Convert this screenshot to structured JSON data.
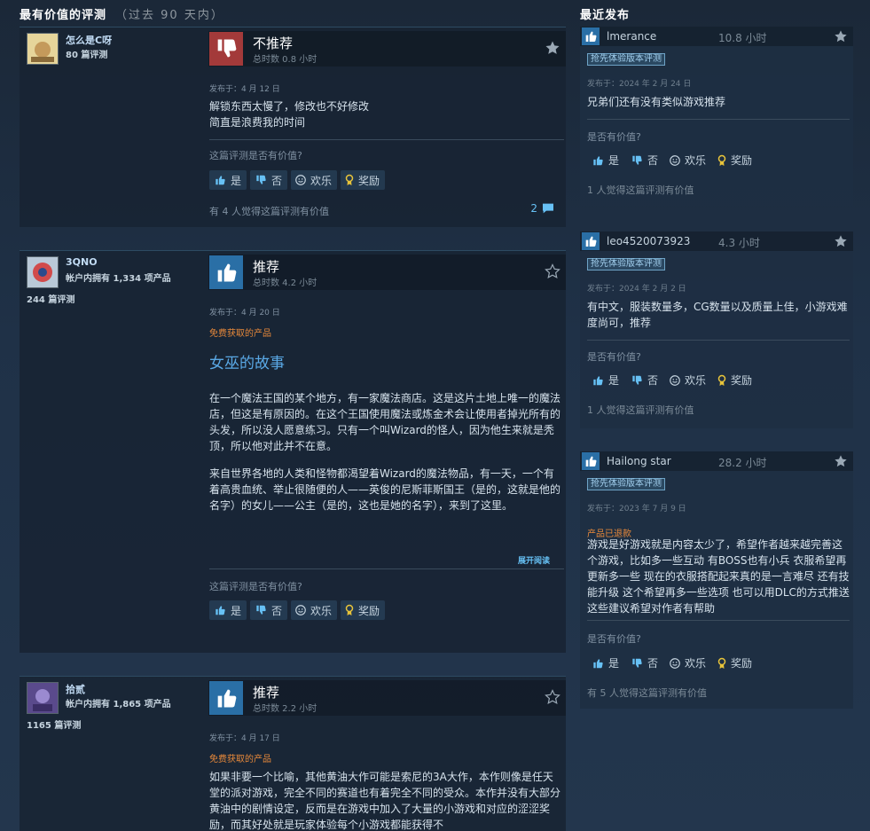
{
  "left_section": {
    "title": "最有价值的评测",
    "subtitle": "（过去 90 天内）"
  },
  "right_section": {
    "title": "最近发布"
  },
  "buttons": {
    "yes": "是",
    "no": "否",
    "funny": "欢乐",
    "award": "奖励"
  },
  "reviews": [
    {
      "author": "怎么是C呀",
      "meta1": "80 篇评测",
      "meta2": "",
      "verdict": "不推荐",
      "hours": "总时数 0.8 小时",
      "posted": "发布于：4 月 12 日",
      "free": "",
      "heading": "",
      "text": [
        "解锁东西太慢了，修改也不好修改",
        "简直是浪费我的时间"
      ],
      "helpful_q": "这篇评测是否有价值?",
      "helpful_count": "有 4 人觉得这篇评测有价值",
      "comments": "2"
    },
    {
      "author": "3QNO",
      "meta1": "帐户内拥有 1,334 项产品",
      "meta2": "244 篇评测",
      "verdict": "推荐",
      "hours": "总时数 4.2 小时",
      "posted": "发布于：4 月 20 日",
      "free": "免费获取的产品",
      "heading": "女巫的故事",
      "text": [
        "在一个魔法王国的某个地方，有一家魔法商店。这是这片土地上唯一的魔法店，但这是有原因的。在这个王国使用魔法或炼金术会让使用者掉光所有的头发，所以没人愿意练习。只有一个叫Wizard的怪人，因为他生来就是秃顶，所以他对此并不在意。",
        "来自世界各地的人类和怪物都渴望着Wizard的魔法物品，有一天，一个有着高贵血统、举止很随便的人——英俊的尼斯菲斯国王（是的，这就是他的名字）的女儿——公主（是的，这也是她的名字），来到了这里。"
      ],
      "expand": "展开阅读",
      "helpful_q": "这篇评测是否有价值?"
    },
    {
      "author": "拾贰",
      "meta1": "帐户内拥有 1,865 项产品",
      "meta2": "1165 篇评测",
      "verdict": "推荐",
      "hours": "总时数 2.2 小时",
      "posted": "发布于：4 月 17 日",
      "free": "免费获取的产品",
      "text": [
        "如果非要一个比喻，其他黄油大作可能是索尼的3A大作，本作则像是任天堂的派对游戏，完全不同的赛道也有着完全不同的受众。本作并没有大部分黄油中的剧情设定，反而是在游戏中加入了大量的小游戏和对应的涩涩奖励，而其好处就是玩家体验每个小游戏都能获得不"
      ]
    }
  ],
  "recent": [
    {
      "name": "lmerance",
      "hours": "10.8 小时",
      "badge": "抢先体验版本评测",
      "posted": "发布于：2024 年 2 月 24 日",
      "refund": "",
      "text": "兄弟们还有没有类似游戏推荐",
      "q": "是否有价值?",
      "count": "1 人觉得这篇评测有价值"
    },
    {
      "name": "leo4520073923",
      "hours": "4.3 小时",
      "badge": "抢先体验版本评测",
      "posted": "发布于：2024 年 2 月 2 日",
      "refund": "",
      "text": "有中文，服装数量多，CG数量以及质量上佳，小游戏难度尚可，推荐",
      "q": "是否有价值?",
      "count": "1 人觉得这篇评测有价值"
    },
    {
      "name": "Hailong star",
      "hours": "28.2 小时",
      "badge": "抢先体验版本评测",
      "posted": "发布于：2023 年 7 月 9 日",
      "refund": "产品已退款",
      "text": "游戏是好游戏就是内容太少了，希望作者越来越完善这个游戏，比如多一些互动 有BOSS也有小兵 衣服希望再更新多一些 现在的衣服搭配起来真的是一言难尽 还有技能升级 这个希望再多一些选项 也可以用DLC的方式推送 这些建议希望对作者有帮助",
      "q": "是否有价值?",
      "count": "有 5 人觉得这篇评测有价值"
    }
  ]
}
